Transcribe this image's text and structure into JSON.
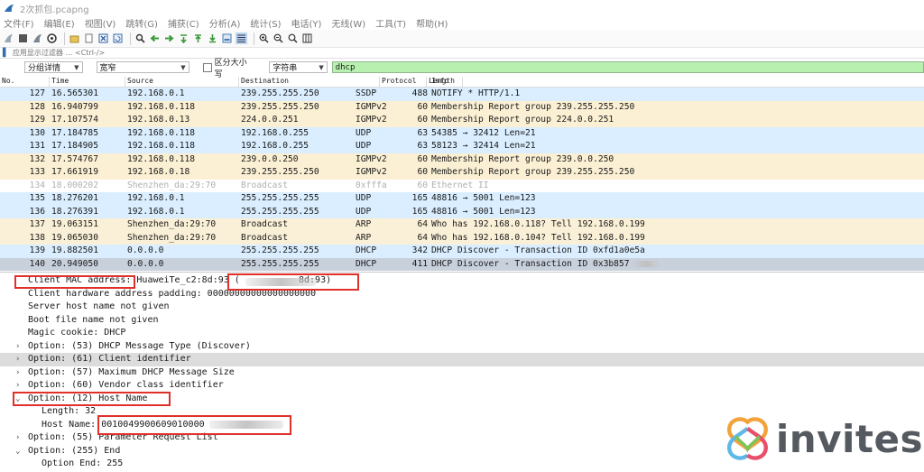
{
  "window": {
    "title": "2次抓包.pcapng"
  },
  "menu": [
    "文件(F)",
    "编辑(E)",
    "视图(V)",
    "跳转(G)",
    "捕获(C)",
    "分析(A)",
    "统计(S)",
    "电话(Y)",
    "无线(W)",
    "工具(T)",
    "帮助(H)"
  ],
  "display_filter": {
    "placeholder": "应用显示过滤器 … <Ctrl-/>"
  },
  "find_bar": {
    "search_in": "分组详情",
    "charset": "宽窄",
    "case_sensitive_label": "区分大小写",
    "search_type": "字符串",
    "search_value": "dhcp"
  },
  "columns": {
    "no": "No.",
    "time": "Time",
    "source": "Source",
    "destination": "Destination",
    "protocol": "Protocol",
    "length": "Length",
    "info": "Info"
  },
  "colors": {
    "udp": "#daeeff",
    "igmp": "#fbf0d4",
    "arp": "#faf0d7",
    "ethernet": "#ffffff",
    "selected": "#c8d0dc",
    "highlight_box": "#e0302a"
  },
  "packets": [
    {
      "no": "127",
      "time": "16.565301",
      "source": "192.168.0.1",
      "destination": "239.255.255.250",
      "protocol": "SSDP",
      "length": "488",
      "info": "NOTIFY * HTTP/1.1",
      "kind": "udp"
    },
    {
      "no": "128",
      "time": "16.940799",
      "source": "192.168.0.118",
      "destination": "239.255.255.250",
      "protocol": "IGMPv2",
      "length": "60",
      "info": "Membership Report group 239.255.255.250",
      "kind": "igmp"
    },
    {
      "no": "129",
      "time": "17.107574",
      "source": "192.168.0.13",
      "destination": "224.0.0.251",
      "protocol": "IGMPv2",
      "length": "60",
      "info": "Membership Report group 224.0.0.251",
      "kind": "igmp"
    },
    {
      "no": "130",
      "time": "17.184785",
      "source": "192.168.0.118",
      "destination": "192.168.0.255",
      "protocol": "UDP",
      "length": "63",
      "info": "54385 → 32412 Len=21",
      "kind": "udp"
    },
    {
      "no": "131",
      "time": "17.184905",
      "source": "192.168.0.118",
      "destination": "192.168.0.255",
      "protocol": "UDP",
      "length": "63",
      "info": "58123 → 32414 Len=21",
      "kind": "udp"
    },
    {
      "no": "132",
      "time": "17.574767",
      "source": "192.168.0.118",
      "destination": "239.0.0.250",
      "protocol": "IGMPv2",
      "length": "60",
      "info": "Membership Report group 239.0.0.250",
      "kind": "igmp"
    },
    {
      "no": "133",
      "time": "17.661919",
      "source": "192.168.0.18",
      "destination": "239.255.255.250",
      "protocol": "IGMPv2",
      "length": "60",
      "info": "Membership Report group 239.255.255.250",
      "kind": "igmp"
    },
    {
      "no": "134",
      "time": "18.000202",
      "source": "Shenzhen_da:29:70",
      "destination": "Broadcast",
      "protocol": "0xfffa",
      "length": "60",
      "info": "Ethernet II",
      "kind": "ethernet"
    },
    {
      "no": "135",
      "time": "18.276201",
      "source": "192.168.0.1",
      "destination": "255.255.255.255",
      "protocol": "UDP",
      "length": "165",
      "info": "48816 → 5001 Len=123",
      "kind": "udp"
    },
    {
      "no": "136",
      "time": "18.276391",
      "source": "192.168.0.1",
      "destination": "255.255.255.255",
      "protocol": "UDP",
      "length": "165",
      "info": "48816 → 5001 Len=123",
      "kind": "udp"
    },
    {
      "no": "137",
      "time": "19.063151",
      "source": "Shenzhen_da:29:70",
      "destination": "Broadcast",
      "protocol": "ARP",
      "length": "64",
      "info": "Who has 192.168.0.118? Tell 192.168.0.199",
      "kind": "arp"
    },
    {
      "no": "138",
      "time": "19.065030",
      "source": "Shenzhen_da:29:70",
      "destination": "Broadcast",
      "protocol": "ARP",
      "length": "64",
      "info": "Who has 192.168.0.104? Tell 192.168.0.199",
      "kind": "arp"
    },
    {
      "no": "139",
      "time": "19.882501",
      "source": "0.0.0.0",
      "destination": "255.255.255.255",
      "protocol": "DHCP",
      "length": "342",
      "info": "DHCP Discover - Transaction ID 0xfd1a0e5a",
      "kind": "udp"
    },
    {
      "no": "140",
      "time": "20.949050",
      "source": "0.0.0.0",
      "destination": "255.255.255.255",
      "protocol": "DHCP",
      "length": "411",
      "info": "DHCP Discover - Transaction ID 0x3b857",
      "kind": "selected"
    }
  ],
  "details": [
    {
      "text": "Client MAC address: HuaweiTe_c2:8d:93 (",
      "tail": "8d:93)",
      "indent": 1,
      "toggle": ""
    },
    {
      "text": "Client hardware address padding: 00000000000000000000",
      "indent": 1,
      "toggle": ""
    },
    {
      "text": "Server host name not given",
      "indent": 1,
      "toggle": ""
    },
    {
      "text": "Boot file name not given",
      "indent": 1,
      "toggle": ""
    },
    {
      "text": "Magic cookie: DHCP",
      "indent": 1,
      "toggle": ""
    },
    {
      "text": "Option: (53) DHCP Message Type (Discover)",
      "indent": 1,
      "toggle": ">"
    },
    {
      "text": "Option: (61) Client identifier",
      "indent": 1,
      "toggle": ">",
      "highlight": true
    },
    {
      "text": "Option: (57) Maximum DHCP Message Size",
      "indent": 1,
      "toggle": ">"
    },
    {
      "text": "Option: (60) Vendor class identifier",
      "indent": 1,
      "toggle": ">"
    },
    {
      "text": "Option: (12) Host Name",
      "indent": 1,
      "toggle": "v"
    },
    {
      "text": "Length: 32",
      "indent": 2,
      "toggle": ""
    },
    {
      "text": "Host Name: 0010049900609010000",
      "indent": 2,
      "toggle": ""
    },
    {
      "text": "Option: (55) Parameter Request List",
      "indent": 1,
      "toggle": ">"
    },
    {
      "text": "Option: (255) End",
      "indent": 1,
      "toggle": "v"
    },
    {
      "text": "Option End: 255",
      "indent": 2,
      "toggle": ""
    }
  ],
  "watermark": {
    "text": "invites",
    "icon": "invites-logo-icon"
  }
}
